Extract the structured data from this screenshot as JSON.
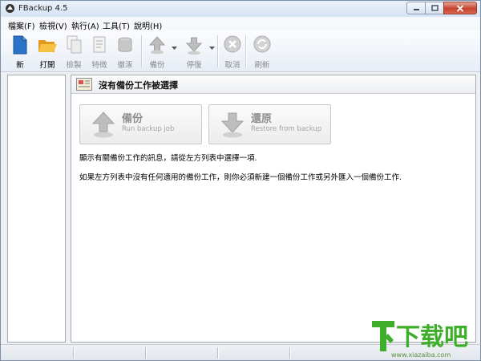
{
  "window": {
    "title": "FBackup  4.5"
  },
  "menu": [
    "檔案(F)",
    "檢視(V)",
    "執行(A)",
    "工具(T)",
    "說明(H)"
  ],
  "toolbar": {
    "new": "新",
    "open": "打開",
    "copy": "檢製",
    "properties": "特徵",
    "delete": "徹涿",
    "backup": "備份",
    "restore": "停復",
    "cancel": "取消",
    "refresh": "刷新"
  },
  "panel": {
    "title": "沒有備份工作被選擇",
    "backup": {
      "title": "備份",
      "subtitle": "Run backup job"
    },
    "restore": {
      "title": "還原",
      "subtitle": "Restore from backup"
    },
    "info1": "顯示有關備份工作的訊息，請從左方列表中選擇一項.",
    "info2": "如果左方列表中沒有任何適用的備份工作，則你必須新建一個備份工作或另外匯入一個備份工作."
  },
  "watermark": {
    "brand": "下载吧",
    "url": "www.xiazaiba.com"
  },
  "colors": {
    "accent_blue": "#2b73c9",
    "folder": "#f2b335",
    "disabled": "#a8a8a8",
    "close_red": "#c6432f",
    "watermark_green": "#3fae2b"
  },
  "icons": [
    "fbackup-app-icon",
    "minimize-icon",
    "maximize-icon",
    "close-icon",
    "new-icon",
    "open-folder-icon",
    "copy-icon",
    "properties-icon",
    "delete-icon",
    "backup-icon",
    "restore-icon",
    "cancel-icon",
    "refresh-icon",
    "dropdown-arrow-icon",
    "no-job-icon"
  ]
}
